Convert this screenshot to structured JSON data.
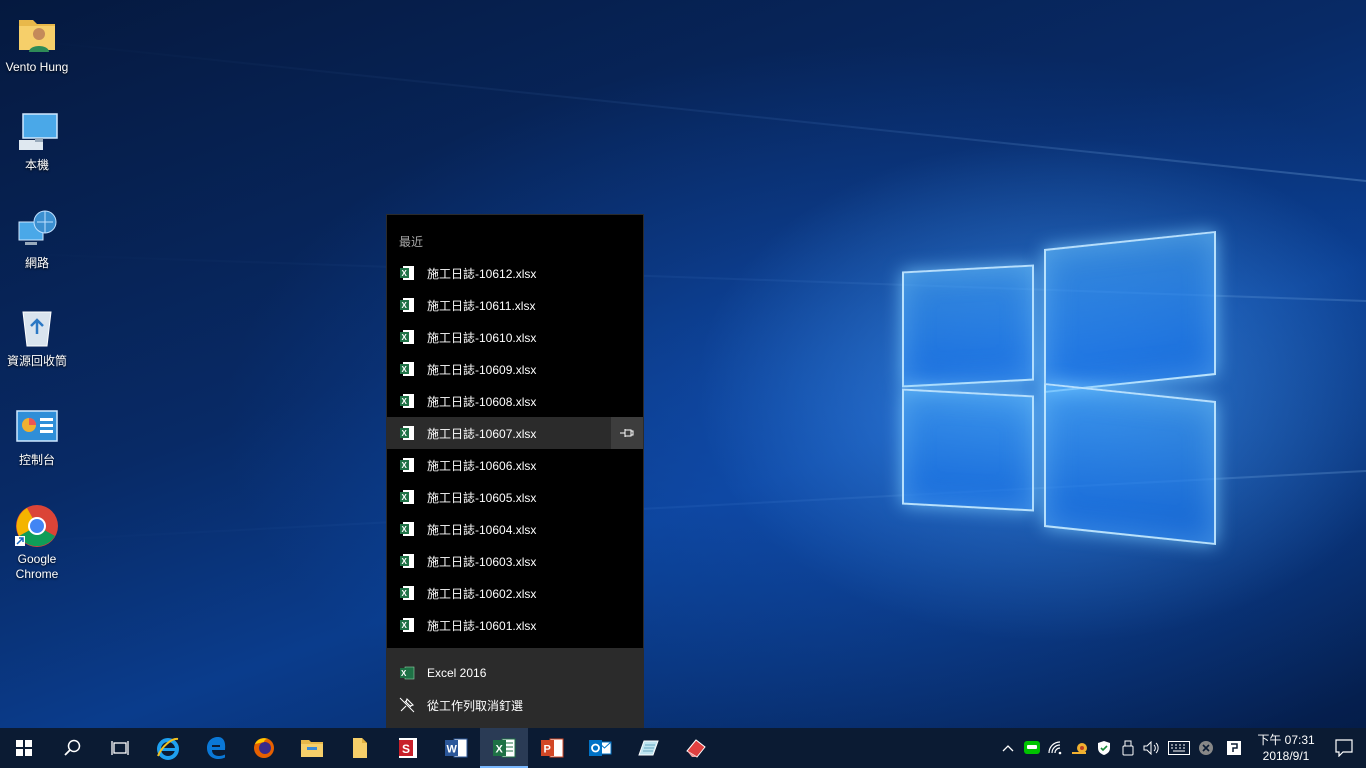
{
  "desktop": {
    "icons": [
      {
        "label": "Vento Hung",
        "icon": "user-folder-icon"
      },
      {
        "label": "本機",
        "icon": "this-pc-icon"
      },
      {
        "label": "網路",
        "icon": "network-icon"
      },
      {
        "label": "資源回收筒",
        "icon": "recycle-bin-icon"
      },
      {
        "label": "控制台",
        "icon": "control-panel-icon"
      },
      {
        "label": "Google Chrome",
        "icon": "chrome-icon"
      }
    ]
  },
  "jumplist": {
    "header": "最近",
    "recent": [
      "施工日誌-10612.xlsx",
      "施工日誌-10611.xlsx",
      "施工日誌-10610.xlsx",
      "施工日誌-10609.xlsx",
      "施工日誌-10608.xlsx",
      "施工日誌-10607.xlsx",
      "施工日誌-10606.xlsx",
      "施工日誌-10605.xlsx",
      "施工日誌-10604.xlsx",
      "施工日誌-10603.xlsx",
      "施工日誌-10602.xlsx",
      "施工日誌-10601.xlsx"
    ],
    "app_name": "Excel 2016",
    "unpin_label": "從工作列取消釘選"
  },
  "taskbar": {
    "apps": [
      "start-icon",
      "search-icon",
      "task-view-icon",
      "internet-explorer-icon",
      "edge-icon",
      "firefox-icon",
      "file-explorer-icon",
      "folder-icon",
      "wps-icon",
      "word-icon",
      "excel-icon",
      "powerpoint-icon",
      "outlook-icon",
      "notepad-icon",
      "eraser-app-icon"
    ],
    "active": "excel-icon",
    "clock": {
      "time": "下午 07:31",
      "date": "2018/9/1"
    }
  },
  "colors": {
    "excel_green": "#1e7145",
    "taskbar": "#0b1b33",
    "accent": "#79b8ff"
  }
}
